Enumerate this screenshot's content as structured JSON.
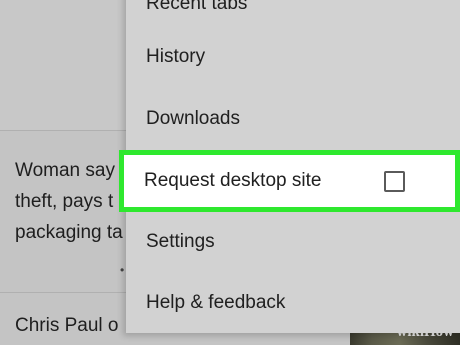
{
  "feed": {
    "article1_lines": [
      "Woman say",
      "theft, pays t",
      "packaging ta"
    ],
    "article2_line": "Chris Paul o"
  },
  "menu": {
    "items": [
      {
        "label": "Recent tabs"
      },
      {
        "label": "History"
      },
      {
        "label": "Downloads"
      },
      {
        "label": "Request desktop site",
        "checked": false
      },
      {
        "label": "Settings"
      },
      {
        "label": "Help & feedback"
      }
    ]
  },
  "watermark": "wikiHow",
  "colors": {
    "highlight_border": "#2ee82e",
    "menu_background": "#d2d2d2"
  }
}
